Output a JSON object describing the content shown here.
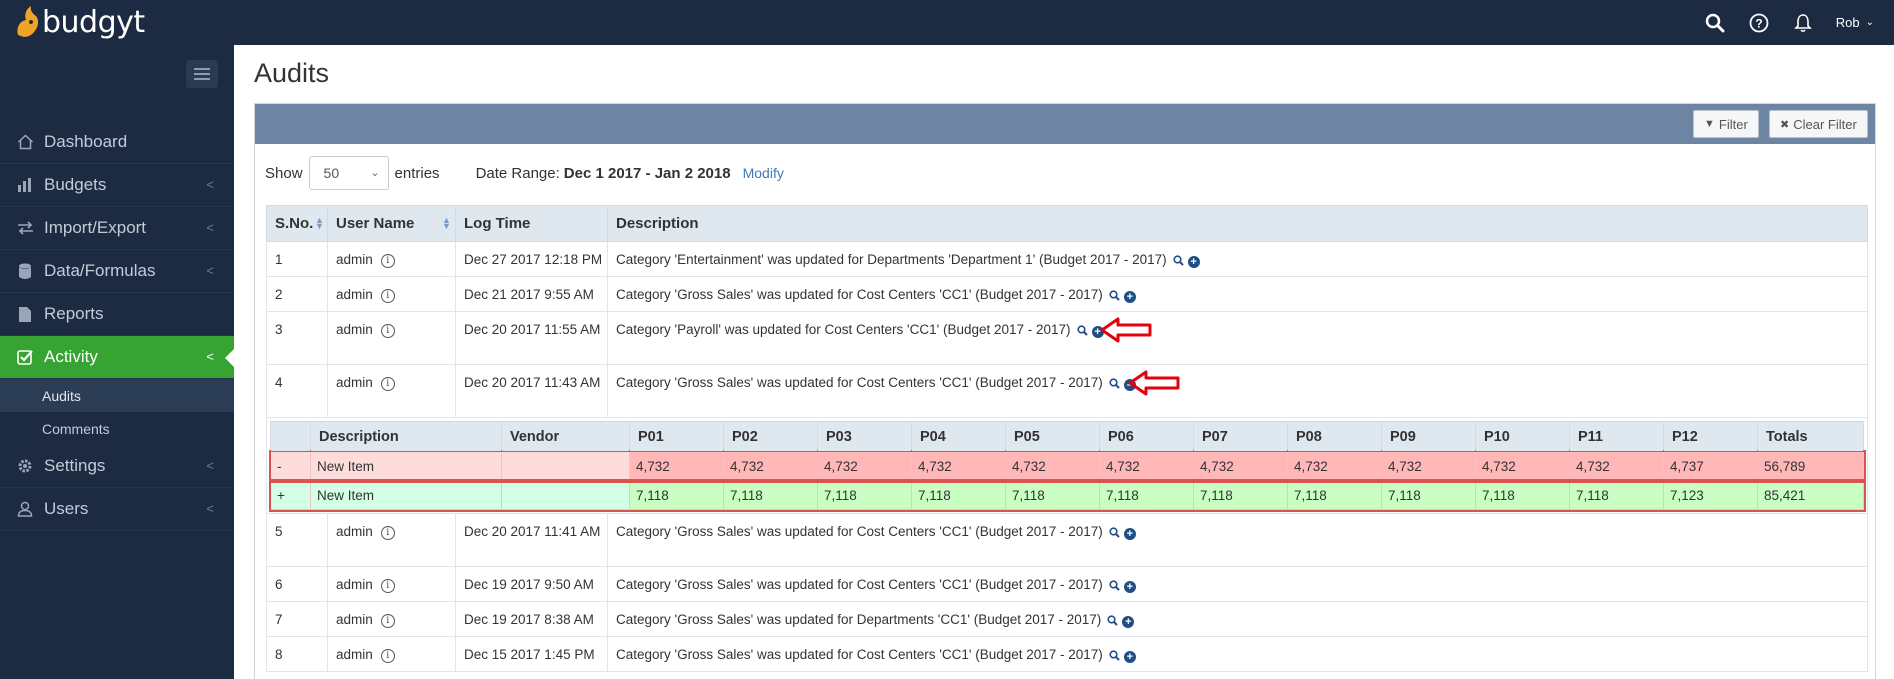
{
  "app": {
    "logo_text": "budgyt",
    "user_name": "Rob",
    "brand_color": "#1c2b41",
    "accent_color": "#35a432"
  },
  "topbar": {
    "icons": [
      "search-icon",
      "help-icon",
      "bell-icon"
    ]
  },
  "sidebar": {
    "items": [
      {
        "label": "Dashboard",
        "icon": "home-icon",
        "has_arrow": false
      },
      {
        "label": "Budgets",
        "icon": "bar-chart-icon",
        "has_arrow": true
      },
      {
        "label": "Import/Export",
        "icon": "exchange-icon",
        "has_arrow": true
      },
      {
        "label": "Data/Formulas",
        "icon": "database-icon",
        "has_arrow": true
      },
      {
        "label": "Reports",
        "icon": "file-icon",
        "has_arrow": false
      },
      {
        "label": "Activity",
        "icon": "check-square-icon",
        "has_arrow": true,
        "active": true
      },
      {
        "label": "Settings",
        "icon": "gear-icon",
        "has_arrow": true
      },
      {
        "label": "Users",
        "icon": "user-icon",
        "has_arrow": true
      }
    ],
    "subitems": [
      {
        "label": "Audits",
        "selected": true
      },
      {
        "label": "Comments",
        "selected": false
      }
    ]
  },
  "page": {
    "title": "Audits",
    "filter_label": "Filter",
    "clear_filter_label": "Clear Filter",
    "show_label": "Show",
    "entries_value": "50",
    "entries_label": "entries",
    "date_range_label": "Date Range:",
    "date_range_value": "Dec 1 2017 - Jan 2 2018",
    "modify_label": "Modify"
  },
  "table": {
    "headers": [
      "S.No.",
      "User Name",
      "Log Time",
      "Description"
    ],
    "rows_before": [
      {
        "sno": "1",
        "user": "admin",
        "time": "Dec 27 2017 12:18 PM",
        "desc": "Category 'Entertainment' was updated for Departments 'Department 1' (Budget 2017 - 2017)"
      },
      {
        "sno": "2",
        "user": "admin",
        "time": "Dec 21 2017 9:55 AM",
        "desc": "Category 'Gross Sales' was updated for Cost Centers 'CC1' (Budget 2017 - 2017)"
      },
      {
        "sno": "3",
        "user": "admin",
        "time": "Dec 20 2017 11:55 AM",
        "desc": "Category 'Payroll' was updated for Cost Centers 'CC1' (Budget 2017 - 2017)"
      },
      {
        "sno": "4",
        "user": "admin",
        "time": "Dec 20 2017 11:43 AM",
        "desc": "Category 'Gross Sales' was updated for Cost Centers 'CC1' (Budget 2017 - 2017)"
      }
    ],
    "rows_after": [
      {
        "sno": "5",
        "user": "admin",
        "time": "Dec 20 2017 11:41 AM",
        "desc": "Category 'Gross Sales' was updated for Cost Centers 'CC1' (Budget 2017 - 2017)"
      },
      {
        "sno": "6",
        "user": "admin",
        "time": "Dec 19 2017 9:50 AM",
        "desc": "Category 'Gross Sales' was updated for Cost Centers 'CC1' (Budget 2017 - 2017)"
      },
      {
        "sno": "7",
        "user": "admin",
        "time": "Dec 19 2017 8:38 AM",
        "desc": "Category 'Gross Sales' was updated for Departments 'CC1' (Budget 2017 - 2017)"
      },
      {
        "sno": "8",
        "user": "admin",
        "time": "Dec 15 2017 1:45 PM",
        "desc": "Category 'Gross Sales' was updated for Cost Centers 'CC1' (Budget 2017 - 2017)"
      }
    ]
  },
  "detail": {
    "headers": [
      "",
      "Description",
      "Vendor",
      "P01",
      "P02",
      "P03",
      "P04",
      "P05",
      "P06",
      "P07",
      "P08",
      "P09",
      "P10",
      "P11",
      "P12",
      "Totals"
    ],
    "minus_row": [
      "-",
      "New Item",
      "",
      "4,732",
      "4,732",
      "4,732",
      "4,732",
      "4,732",
      "4,732",
      "4,732",
      "4,732",
      "4,732",
      "4,732",
      "4,732",
      "4,737",
      "56,789"
    ],
    "plus_row": [
      "+",
      "New Item",
      "",
      "7,118",
      "7,118",
      "7,118",
      "7,118",
      "7,118",
      "7,118",
      "7,118",
      "7,118",
      "7,118",
      "7,118",
      "7,118",
      "7,123",
      "85,421"
    ]
  }
}
